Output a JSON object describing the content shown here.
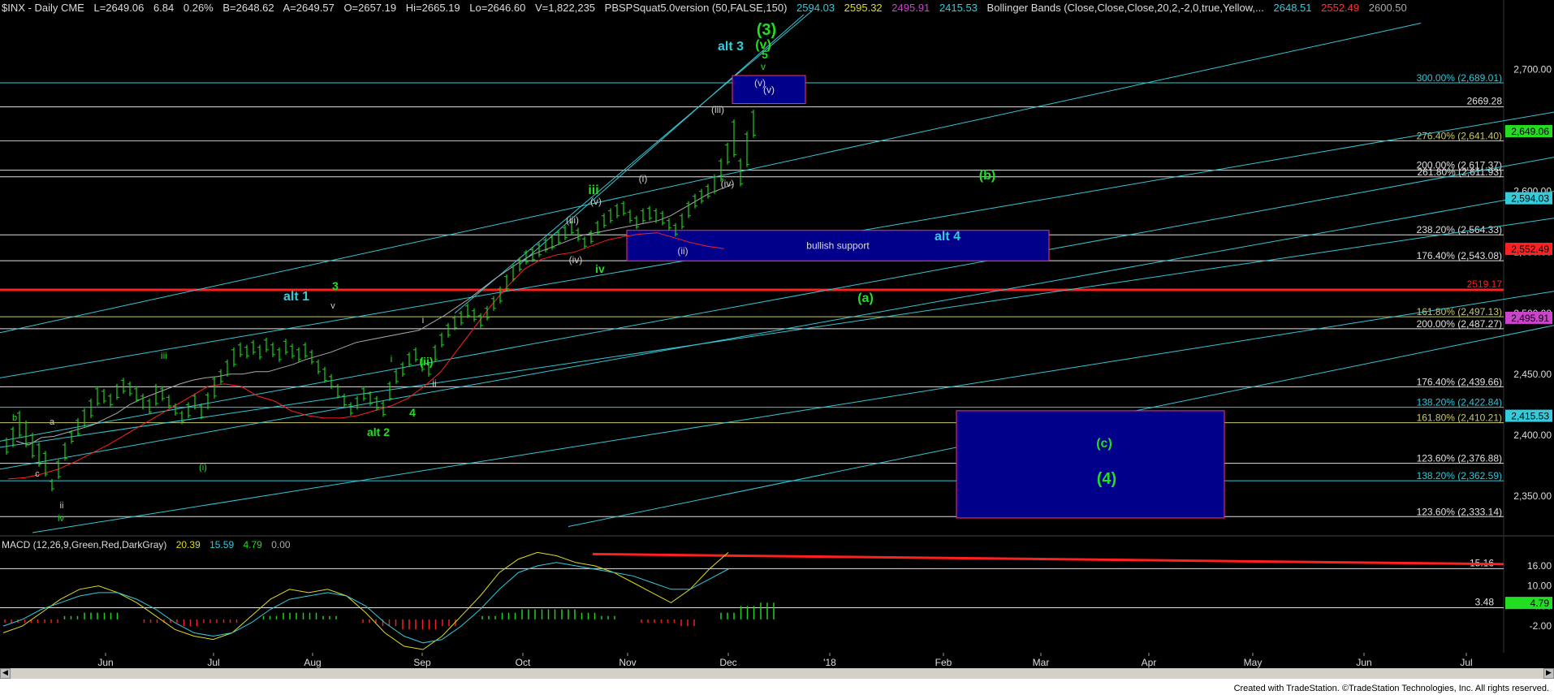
{
  "header": {
    "symbol": "$INX - Daily  CME",
    "last": "L=2649.06",
    "change": "6.84",
    "pct": "0.26%",
    "bid": "B=2648.62",
    "ask": "A=2649.57",
    "open": "O=2657.19",
    "high": "Hi=2665.19",
    "low": "Lo=2646.60",
    "volume": "V=1,822,235",
    "study1": "PBSPSquat5.0version (50,FALSE,150)",
    "study1_values": [
      "2594.03",
      "2595.32",
      "2495.91",
      "2415.53"
    ],
    "study2": "Bollinger Bands (Close,Close,Close,20,2,-2,0,true,Yellow,...",
    "study2_values": [
      "2648.51",
      "2552.49",
      "2600.50"
    ]
  },
  "macd_header": {
    "label": "MACD (12,26,9,Green,Red,DarkGray)",
    "values": [
      "20.39",
      "15.59",
      "4.79",
      "0.00"
    ]
  },
  "footer": "Created with TradeStation. ©TradeStation Technologies, Inc. All rights reserved.",
  "colors": {
    "background": "#000000",
    "channel": "#33c6d6",
    "price_bars": "#22cc22",
    "red": "#ff2020",
    "box": "#00008b",
    "box_border": "#ff3366",
    "label_green": "#22dd22",
    "label_cyan": "#33ccdd"
  },
  "chart_data": {
    "type": "ohlc",
    "x_ticks": [
      "Jun",
      "Jul",
      "Aug",
      "Sep",
      "Oct",
      "Nov",
      "Dec",
      "'18",
      "Feb",
      "Mar",
      "Apr",
      "May",
      "Jun",
      "Jul"
    ],
    "y_ticks": [
      "2,700.00",
      "2,650.00",
      "2,600.00",
      "2,550.00",
      "2,500.00",
      "2,450.00",
      "2,400.00",
      "2,350.00"
    ],
    "ylim": [
      2320,
      2745
    ],
    "macd_ticks": [
      "16.00",
      "10.00",
      "4.00",
      "-2.00"
    ],
    "macd_ylim": [
      -9,
      23
    ],
    "price_path": [
      [
        2396,
        2386
      ],
      [
        2405,
        2392
      ],
      [
        2418,
        2400
      ],
      [
        2410,
        2392
      ],
      [
        2400,
        2383
      ],
      [
        2392,
        2376
      ],
      [
        2385,
        2368
      ],
      [
        2362,
        2356
      ],
      [
        2378,
        2366
      ],
      [
        2392,
        2381
      ],
      [
        2402,
        2395
      ],
      [
        2412,
        2401
      ],
      [
        2420,
        2408
      ],
      [
        2428,
        2416
      ],
      [
        2438,
        2426
      ],
      [
        2436,
        2428
      ],
      [
        2432,
        2425
      ],
      [
        2440,
        2431
      ],
      [
        2445,
        2436
      ],
      [
        2442,
        2434
      ],
      [
        2438,
        2429
      ],
      [
        2432,
        2423
      ],
      [
        2428,
        2419
      ],
      [
        2440,
        2426
      ],
      [
        2438,
        2430
      ],
      [
        2431,
        2424
      ],
      [
        2424,
        2418
      ],
      [
        2418,
        2411
      ],
      [
        2425,
        2416
      ],
      [
        2432,
        2423
      ],
      [
        2424,
        2415
      ],
      [
        2433,
        2423
      ],
      [
        2446,
        2432
      ],
      [
        2452,
        2444
      ],
      [
        2460,
        2450
      ],
      [
        2470,
        2458
      ],
      [
        2474,
        2466
      ],
      [
        2472,
        2465
      ],
      [
        2476,
        2468
      ],
      [
        2472,
        2464
      ],
      [
        2478,
        2470
      ],
      [
        2474,
        2466
      ],
      [
        2470,
        2462
      ],
      [
        2477,
        2468
      ],
      [
        2473,
        2465
      ],
      [
        2470,
        2462
      ],
      [
        2474,
        2465
      ],
      [
        2468,
        2460
      ],
      [
        2460,
        2452
      ],
      [
        2454,
        2445
      ],
      [
        2448,
        2440
      ],
      [
        2440,
        2432
      ],
      [
        2432,
        2425
      ],
      [
        2425,
        2418
      ],
      [
        2430,
        2423
      ],
      [
        2438,
        2430
      ],
      [
        2434,
        2426
      ],
      [
        2430,
        2422
      ],
      [
        2426,
        2417
      ],
      [
        2442,
        2430
      ],
      [
        2452,
        2444
      ],
      [
        2458,
        2450
      ],
      [
        2466,
        2458
      ],
      [
        2470,
        2462
      ],
      [
        2462,
        2454
      ],
      [
        2458,
        2450
      ],
      [
        2472,
        2462
      ],
      [
        2482,
        2474
      ],
      [
        2490,
        2482
      ],
      [
        2496,
        2488
      ],
      [
        2500,
        2492
      ],
      [
        2506,
        2498
      ],
      [
        2502,
        2495
      ],
      [
        2498,
        2490
      ],
      [
        2504,
        2496
      ],
      [
        2512,
        2504
      ],
      [
        2520,
        2510
      ],
      [
        2530,
        2520
      ],
      [
        2538,
        2528
      ],
      [
        2544,
        2536
      ],
      [
        2550,
        2542
      ],
      [
        2552,
        2544
      ],
      [
        2556,
        2548
      ],
      [
        2560,
        2552
      ],
      [
        2562,
        2554
      ],
      [
        2566,
        2558
      ],
      [
        2570,
        2562
      ],
      [
        2574,
        2566
      ],
      [
        2568,
        2561
      ],
      [
        2561,
        2555
      ],
      [
        2566,
        2559
      ],
      [
        2574,
        2566
      ],
      [
        2580,
        2572
      ],
      [
        2584,
        2576
      ],
      [
        2588,
        2580
      ],
      [
        2590,
        2582
      ],
      [
        2583,
        2576
      ],
      [
        2578,
        2571
      ],
      [
        2584,
        2576
      ],
      [
        2586,
        2578
      ],
      [
        2584,
        2576
      ],
      [
        2582,
        2574
      ],
      [
        2576,
        2570
      ],
      [
        2572,
        2565
      ],
      [
        2580,
        2571
      ],
      [
        2590,
        2580
      ],
      [
        2596,
        2588
      ],
      [
        2600,
        2592
      ],
      [
        2604,
        2596
      ],
      [
        2612,
        2600
      ],
      [
        2625,
        2610
      ],
      [
        2638,
        2624
      ],
      [
        2657,
        2630
      ],
      [
        2625,
        2606
      ],
      [
        2647,
        2622
      ],
      [
        2665,
        2646
      ]
    ],
    "bollinger_mid": [
      [
        2395,
        2392
      ],
      [
        2398,
        2399
      ],
      [
        2402,
        2405
      ],
      [
        2408,
        2413
      ],
      [
        2418,
        2425
      ],
      [
        2430,
        2434
      ],
      [
        2438,
        2442
      ],
      [
        2445,
        2447
      ],
      [
        2448,
        2450
      ],
      [
        2450,
        2452
      ],
      [
        2452,
        2455
      ],
      [
        2458,
        2462
      ],
      [
        2465,
        2468
      ],
      [
        2472,
        2476
      ],
      [
        2478,
        2480
      ],
      [
        2482,
        2484
      ],
      [
        2486,
        2492
      ],
      [
        2498,
        2505
      ],
      [
        2512,
        2520
      ],
      [
        2528,
        2535
      ],
      [
        2542,
        2548
      ],
      [
        2552,
        2556
      ],
      [
        2560,
        2564
      ],
      [
        2566,
        2568
      ],
      [
        2570,
        2572
      ],
      [
        2574,
        2576
      ],
      [
        2580,
        2586
      ],
      [
        2592,
        2598
      ],
      [
        2602,
        2606
      ]
    ],
    "red_ma": [
      [
        2364,
        2365
      ],
      [
        2368,
        2372
      ],
      [
        2378,
        2385
      ],
      [
        2392,
        2400
      ],
      [
        2408,
        2416
      ],
      [
        2424,
        2432
      ],
      [
        2440,
        2442
      ],
      [
        2440,
        2432
      ],
      [
        2428,
        2420
      ],
      [
        2416,
        2414
      ],
      [
        2414,
        2416
      ],
      [
        2420,
        2424
      ],
      [
        2430,
        2440
      ],
      [
        2452,
        2470
      ],
      [
        2488,
        2506
      ],
      [
        2522,
        2536
      ],
      [
        2544,
        2548
      ],
      [
        2550,
        2555
      ],
      [
        2560,
        2563
      ],
      [
        2565,
        2566
      ],
      [
        2562,
        2558
      ],
      [
        2555,
        2553
      ]
    ],
    "macd_line": [
      [
        -4,
        -2
      ],
      [
        2,
        6
      ],
      [
        9,
        10
      ],
      [
        8,
        5
      ],
      [
        1,
        -3
      ],
      [
        -5,
        -6
      ],
      [
        -4,
        1
      ],
      [
        6,
        9
      ],
      [
        8,
        9
      ],
      [
        7,
        2
      ],
      [
        -4,
        -8
      ],
      [
        -9,
        -5
      ],
      [
        1,
        7
      ],
      [
        14,
        18
      ],
      [
        20,
        19
      ],
      [
        17,
        16
      ],
      [
        14,
        11
      ],
      [
        8,
        5
      ],
      [
        9,
        15
      ],
      [
        20
      ]
    ],
    "signal_line": [
      [
        -2,
        0
      ],
      [
        3,
        5
      ],
      [
        7,
        8
      ],
      [
        8,
        6
      ],
      [
        3,
        -1
      ],
      [
        -4,
        -5
      ],
      [
        -4,
        -1
      ],
      [
        3,
        6
      ],
      [
        7,
        8
      ],
      [
        7,
        4
      ],
      [
        -1,
        -5
      ],
      [
        -7,
        -6
      ],
      [
        -2,
        3
      ],
      [
        9,
        14
      ],
      [
        16,
        17
      ],
      [
        16,
        15
      ],
      [
        14,
        13
      ],
      [
        11,
        9
      ],
      [
        9,
        12
      ],
      [
        15
      ]
    ],
    "macd_hist": [
      [
        -1,
        -1
      ],
      [
        -1,
        1
      ],
      [
        2,
        2
      ],
      [
        0,
        -1
      ],
      [
        -1,
        -2
      ],
      [
        -1,
        -1
      ],
      [
        0,
        1
      ],
      [
        2,
        2
      ],
      [
        1,
        0
      ],
      [
        -1,
        -2
      ],
      [
        -3,
        -3
      ],
      [
        -2,
        0
      ],
      [
        1,
        2
      ],
      [
        3,
        3
      ],
      [
        3,
        2
      ],
      [
        1,
        0
      ],
      [
        -1,
        -1
      ],
      [
        -2,
        0
      ],
      [
        2,
        4
      ],
      [
        5
      ]
    ],
    "fib_lines": [
      {
        "pct": "300.00%",
        "price": "2,689.01",
        "color": "#33c6d6"
      },
      {
        "pct": "276.40%",
        "price": "2,641.40",
        "color": "#c8c870"
      },
      {
        "pct": "200.00%",
        "price": "2,617.37",
        "color": "#e0e0e0"
      },
      {
        "pct": "261.80%",
        "price": "2,611.93",
        "color": "#e0e0e0"
      },
      {
        "pct": "238.20%",
        "price": "2,564.33",
        "color": "#e0e0e0"
      },
      {
        "pct": "176.40%",
        "price": "2,543.08",
        "color": "#e0e0e0"
      },
      {
        "pct": "161.80%",
        "price": "2,497.13",
        "color": "#c8c870"
      },
      {
        "pct": "200.00%",
        "price": "2,487.27",
        "color": "#e0e0e0"
      },
      {
        "pct": "176.40%",
        "price": "2,439.66",
        "color": "#e0e0e0"
      },
      {
        "pct": "138.20%",
        "price": "2,422.84",
        "color": "#33c6d6"
      },
      {
        "pct": "161.80%",
        "price": "2,410.21",
        "color": "#c8c870"
      },
      {
        "pct": "123.60%",
        "price": "2,376.88",
        "color": "#e0e0e0"
      },
      {
        "pct": "138.20%",
        "price": "2,362.59",
        "color": "#33c6d6"
      },
      {
        "pct": "123.60%",
        "price": "2,333.14",
        "color": "#e0e0e0"
      }
    ],
    "hlines": [
      {
        "value": "2669.28",
        "color": "#e0e0e0"
      },
      {
        "value": "2519.17",
        "color": "#ff2020"
      }
    ],
    "macd_lines": [
      {
        "value": "15.16",
        "color": "#e0e0e0"
      },
      {
        "value": "3.48",
        "color": "#e0e0e0"
      }
    ],
    "right_tags": [
      {
        "value": "2,649.06",
        "color": "#22dd22"
      },
      {
        "value": "2,594.03",
        "color": "#33ccdd"
      },
      {
        "value": "2,552.49",
        "color": "#ff2020"
      },
      {
        "value": "2,495.91",
        "color": "#cc44cc"
      },
      {
        "value": "2,415.53",
        "color": "#33ccdd"
      }
    ],
    "macd_tags": [
      {
        "value": "4.79",
        "color": "#22dd22"
      }
    ],
    "boxes": [
      {
        "label": "(v)",
        "range": [
          2672,
          2695
        ]
      },
      {
        "label": "bullish support",
        "range": [
          2543,
          2568
        ]
      },
      {
        "label": "",
        "range": [
          2332,
          2420
        ]
      }
    ],
    "wave_labels": [
      "(3)",
      "(v)",
      "alt 3",
      "5",
      "v",
      "(v)",
      "(iii)",
      "(i)",
      "(iv)",
      "iii",
      "(v)",
      "(iii)",
      "(iv)",
      "iv",
      "(ii)",
      "(b)",
      "alt 4",
      "(a)",
      "(c)",
      "(4)",
      "alt 1",
      "3",
      "v",
      "iii",
      "i",
      "b",
      "a",
      "c",
      "ii",
      "iv",
      "(i)",
      "i",
      "(ii)",
      "ii",
      "4",
      "alt 2"
    ]
  }
}
